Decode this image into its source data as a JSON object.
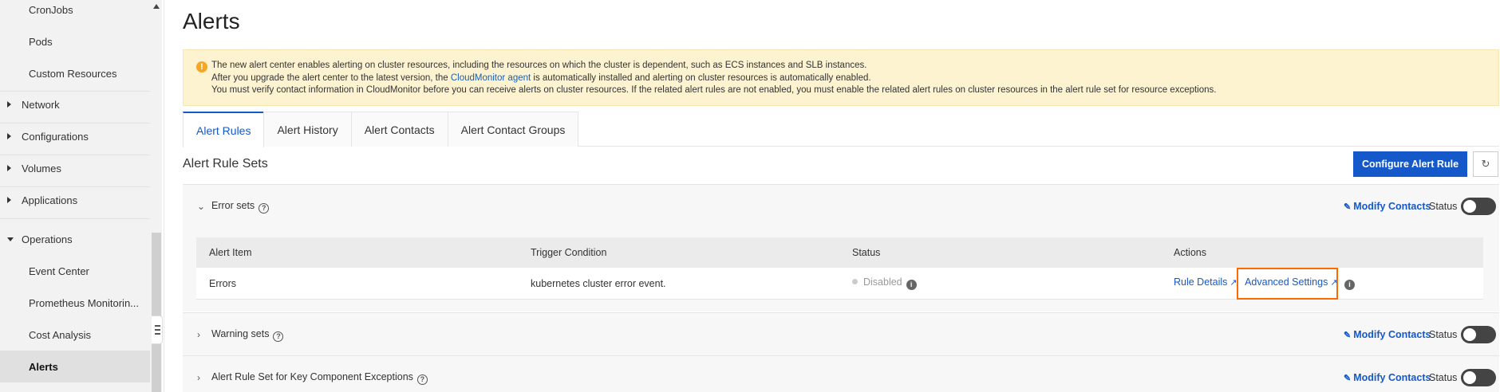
{
  "sidebar": {
    "items": [
      {
        "label": "CronJobs"
      },
      {
        "label": "Pods"
      },
      {
        "label": "Custom Resources"
      },
      {
        "label": "Network"
      },
      {
        "label": "Configurations"
      },
      {
        "label": "Volumes"
      },
      {
        "label": "Applications"
      },
      {
        "label": "Operations"
      },
      {
        "label": "Event Center"
      },
      {
        "label": "Prometheus Monitorin..."
      },
      {
        "label": "Cost Analysis"
      },
      {
        "label": "Alerts"
      }
    ]
  },
  "page": {
    "title": "Alerts"
  },
  "notice": {
    "line1": "The new alert center enables alerting on cluster resources, including the resources on which the cluster is dependent, such as ECS instances and SLB instances.",
    "line2_before": "After you upgrade the alert center to the latest version, the ",
    "line2_link": "CloudMonitor agent",
    "line2_after": " is automatically installed and alerting on cluster resources is automatically enabled.",
    "line3": "You must verify contact information in CloudMonitor before you can receive alerts on cluster resources. If the related alert rules are not enabled, you must enable the related alert rules on cluster resources in the alert rule set for resource exceptions."
  },
  "tabs": [
    {
      "label": "Alert Rules"
    },
    {
      "label": "Alert History"
    },
    {
      "label": "Alert Contacts"
    },
    {
      "label": "Alert Contact Groups"
    }
  ],
  "rule_sets": {
    "title": "Alert Rule Sets",
    "configure_button": "Configure Alert Rule",
    "modify_contacts": "Modify Contacts",
    "status_label": "Status",
    "sections": [
      {
        "name": "Error sets",
        "status_on": false
      },
      {
        "name": "Warning sets",
        "status_on": false
      },
      {
        "name": "Alert Rule Set for Key Component Exceptions",
        "status_on": false
      }
    ],
    "table": {
      "headers": [
        "Alert Item",
        "Trigger Condition",
        "Status",
        "Actions"
      ],
      "rows": [
        {
          "item": "Errors",
          "trigger": "kubernetes cluster error event.",
          "status": "Disabled",
          "action_rule_details": "Rule Details",
          "action_advanced": "Advanced Settings"
        }
      ]
    }
  },
  "colors": {
    "accent": "#1558c9",
    "highlight": "#ff6a00",
    "notice_bg": "#fdf3d1"
  }
}
